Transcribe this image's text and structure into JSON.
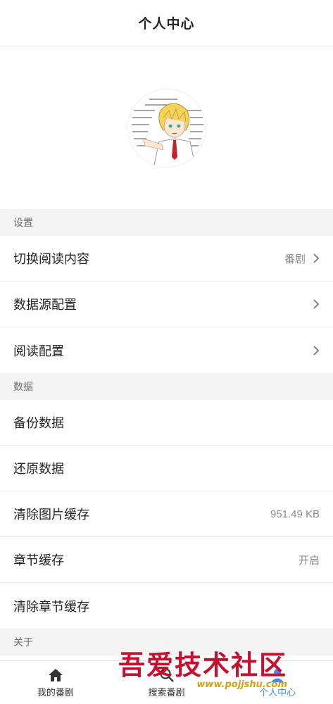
{
  "header": {
    "title": "个人中心"
  },
  "sections": [
    {
      "title": "设置",
      "rows": [
        {
          "label": "切换阅读内容",
          "value": "番剧",
          "chevron": true
        },
        {
          "label": "数据源配置",
          "value": "",
          "chevron": true
        },
        {
          "label": "阅读配置",
          "value": "",
          "chevron": true
        }
      ]
    },
    {
      "title": "数据",
      "rows": [
        {
          "label": "备份数据",
          "value": "",
          "chevron": false
        },
        {
          "label": "还原数据",
          "value": "",
          "chevron": false
        },
        {
          "label": "清除图片缓存",
          "value": "951.49 KB",
          "chevron": false
        },
        {
          "label": "章节缓存",
          "value": "开启",
          "chevron": false
        },
        {
          "label": "清除章节缓存",
          "value": "",
          "chevron": false
        }
      ]
    },
    {
      "title": "关于",
      "rows": []
    }
  ],
  "tabbar": [
    {
      "label": "我的番剧",
      "icon": "home-icon",
      "active": false
    },
    {
      "label": "搜索番剧",
      "icon": "search-icon",
      "active": false
    },
    {
      "label": "个人中心",
      "icon": "user-icon",
      "active": true
    }
  ],
  "watermark": {
    "title": "吾爱技术社区",
    "url": "www.pojjshu.com"
  },
  "colors": {
    "accent": "#3b8ef0",
    "watermark_red": "#c8102e",
    "section_bg": "#f4f4f5"
  }
}
